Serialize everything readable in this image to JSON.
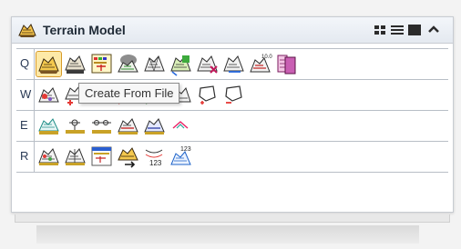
{
  "window": {
    "title": "Terrain Model"
  },
  "header_buttons": [
    "grid-view",
    "list-view",
    "panel-view",
    "collapse"
  ],
  "rows": [
    {
      "key": "Q",
      "tools": [
        "create-from-file",
        "create-from-elements",
        "create-from-graphical-filter",
        "create-from-point-cloud",
        "create-from-text-file",
        "create-clipped",
        "create-complex",
        "create-delta",
        "create-from-elevation",
        "merge-terrain"
      ]
    },
    {
      "key": "W",
      "tools": [
        "add-features",
        "add-spots",
        "delete-features",
        "drape-linear",
        "draw-line",
        "edit-terrain",
        "insert-point",
        "remove-point"
      ]
    },
    {
      "key": "E",
      "tools": [
        "analyze-terrain",
        "analyze-point",
        "analyze-trace",
        "analyze-elevation",
        "analyze-slope",
        "analyze-peak"
      ]
    },
    {
      "key": "R",
      "tools": [
        "label-contours",
        "label-spots",
        "import-terrain",
        "export-terrain",
        "contour-labels",
        "elevation-labels"
      ]
    }
  ],
  "tooltip": {
    "text": "Create From File"
  },
  "colors": {
    "selected_fill": "#fde9a7",
    "selected_border": "#d79a28",
    "row_key_text": "#2a3a55"
  }
}
